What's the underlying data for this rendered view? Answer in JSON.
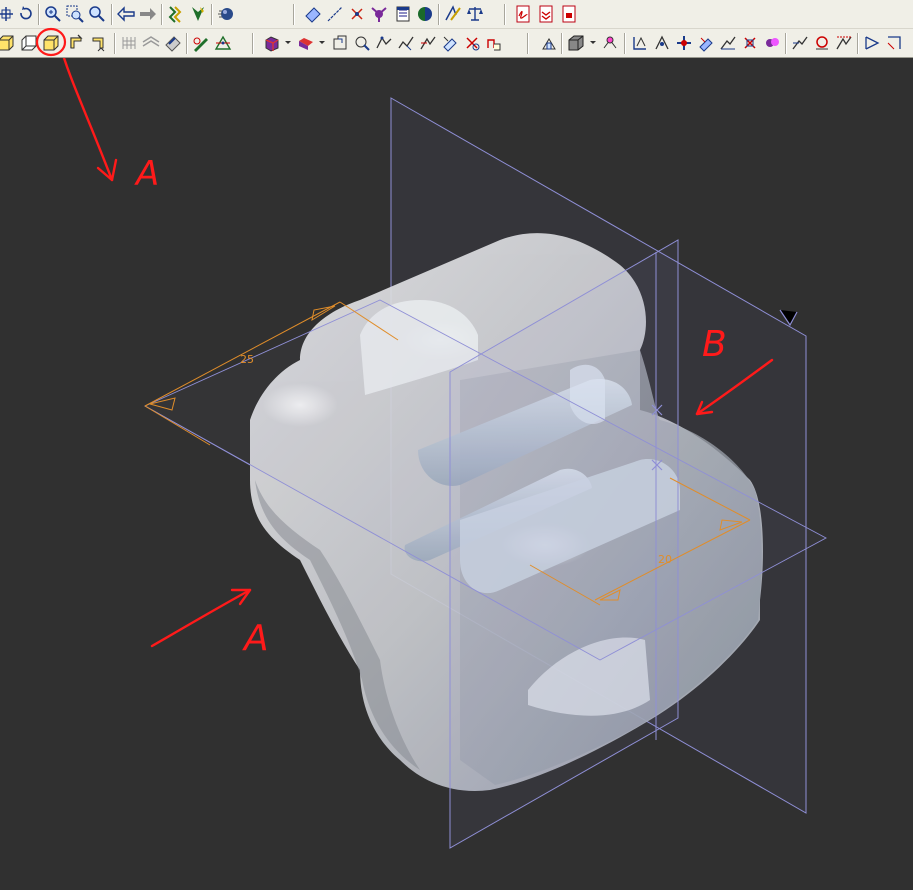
{
  "colors": {
    "viewport_bg": "#303030",
    "toolbar_bg": "#f0efe7",
    "dimension": "#e08d2a",
    "plane": "#8f8fd6",
    "annotation": "#ff1a1a"
  },
  "toolbar_row1": [
    {
      "name": "pan-icon"
    },
    {
      "name": "rotate-icon"
    },
    {
      "name": "zoom-in-icon"
    },
    {
      "name": "zoom-window-icon"
    },
    {
      "name": "zoom-icon"
    },
    {
      "name": "previous-view-icon"
    },
    {
      "name": "next-view-icon"
    },
    {
      "name": "named-views-icon"
    },
    {
      "name": "flag-view-icon"
    },
    {
      "name": "render-sphere-icon"
    },
    {
      "name": "plane-icon"
    },
    {
      "name": "axis-icon"
    },
    {
      "name": "point-icon"
    },
    {
      "name": "coordinate-system-icon"
    },
    {
      "name": "layer-icon"
    },
    {
      "name": "shading-icon"
    },
    {
      "name": "measure-icon"
    },
    {
      "name": "balance-icon"
    },
    {
      "name": "pdf-icon"
    },
    {
      "name": "pdf-export-icon"
    },
    {
      "name": "pdf-publish-icon"
    }
  ],
  "toolbar_row2": [
    {
      "name": "view-front-icon"
    },
    {
      "name": "view-back-icon"
    },
    {
      "name": "view-isometric-icon"
    },
    {
      "name": "view-rotate-left-icon"
    },
    {
      "name": "view-rotate-right-icon"
    },
    {
      "name": "grid-icon"
    },
    {
      "name": "section-icon"
    },
    {
      "name": "sketch-plane-icon"
    },
    {
      "name": "edit-sketch-icon"
    },
    {
      "name": "origin-icon"
    },
    {
      "name": "display-style-icon"
    },
    {
      "name": "hidden-lines-icon"
    },
    {
      "name": "constraint-icon"
    },
    {
      "name": "relation-1-icon"
    },
    {
      "name": "relation-2-icon"
    },
    {
      "name": "relation-3-icon"
    },
    {
      "name": "relation-4-icon"
    },
    {
      "name": "relation-5-icon"
    },
    {
      "name": "relation-6-icon"
    },
    {
      "name": "assembly-icon"
    },
    {
      "name": "cube-icon"
    },
    {
      "name": "part-icon"
    },
    {
      "name": "feature-1-icon"
    },
    {
      "name": "feature-2-icon"
    },
    {
      "name": "feature-3-icon"
    },
    {
      "name": "feature-4-icon"
    },
    {
      "name": "feature-5-icon"
    },
    {
      "name": "feature-6-icon"
    },
    {
      "name": "feature-7-icon"
    },
    {
      "name": "feature-8-icon"
    },
    {
      "name": "feature-9-icon"
    },
    {
      "name": "feature-10-icon"
    },
    {
      "name": "feature-11-icon"
    },
    {
      "name": "feature-12-icon"
    }
  ],
  "dimensions": {
    "upper": "25",
    "lower": "20"
  },
  "annotations": {
    "arrow_a_upper": "A",
    "arrow_a_lower": "A",
    "arrow_b": "B"
  }
}
